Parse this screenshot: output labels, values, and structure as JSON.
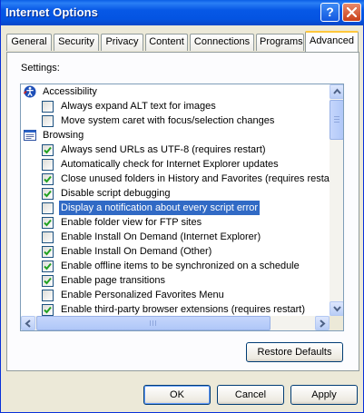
{
  "window": {
    "title": "Internet Options",
    "help_glyph": "?",
    "colors": {
      "titlebar": "#0758e6",
      "selection": "#316ac5",
      "close_button": "#c9401a",
      "active_tab_accent": "#ffc73c",
      "checkmark": "#21a121"
    }
  },
  "tabs": [
    {
      "label": "General",
      "active": false
    },
    {
      "label": "Security",
      "active": false
    },
    {
      "label": "Privacy",
      "active": false
    },
    {
      "label": "Content",
      "active": false
    },
    {
      "label": "Connections",
      "active": false
    },
    {
      "label": "Programs",
      "active": false
    },
    {
      "label": "Advanced",
      "active": true
    }
  ],
  "settings_label": "Settings:",
  "settings": [
    {
      "kind": "category",
      "label": "Accessibility",
      "icon": "accessibility-icon"
    },
    {
      "kind": "option",
      "label": "Always expand ALT text for images",
      "checked": false
    },
    {
      "kind": "option",
      "label": "Move system caret with focus/selection changes",
      "checked": false
    },
    {
      "kind": "category",
      "label": "Browsing",
      "icon": "browsing-icon"
    },
    {
      "kind": "option",
      "label": "Always send URLs as UTF-8 (requires restart)",
      "checked": true
    },
    {
      "kind": "option",
      "label": "Automatically check for Internet Explorer updates",
      "checked": false
    },
    {
      "kind": "option",
      "label": "Close unused folders in History and Favorites (requires restart)",
      "checked": true
    },
    {
      "kind": "option",
      "label": "Disable script debugging",
      "checked": true
    },
    {
      "kind": "option",
      "label": "Display a notification about every script error",
      "checked": false,
      "selected": true
    },
    {
      "kind": "option",
      "label": "Enable folder view for FTP sites",
      "checked": true
    },
    {
      "kind": "option",
      "label": "Enable Install On Demand (Internet Explorer)",
      "checked": false
    },
    {
      "kind": "option",
      "label": "Enable Install On Demand (Other)",
      "checked": true
    },
    {
      "kind": "option",
      "label": "Enable offline items to be synchronized on a schedule",
      "checked": true
    },
    {
      "kind": "option",
      "label": "Enable page transitions",
      "checked": true
    },
    {
      "kind": "option",
      "label": "Enable Personalized Favorites Menu",
      "checked": false
    },
    {
      "kind": "option",
      "label": "Enable third-party browser extensions (requires restart)",
      "checked": true
    }
  ],
  "buttons": {
    "restore": "Restore Defaults",
    "ok": "OK",
    "cancel": "Cancel",
    "apply": "Apply"
  }
}
